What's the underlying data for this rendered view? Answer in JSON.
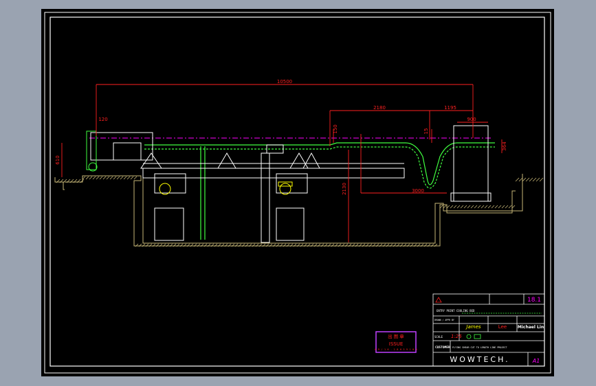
{
  "dimensions": {
    "overall_length": "10500",
    "segment_a": "2180",
    "segment_b": "1195",
    "upper_width": "900",
    "left_small": "120",
    "left_height": "610",
    "rise_150": "150",
    "rise_15": "15",
    "side_364": "364",
    "pit_depth": "2130",
    "loop_width": "3000"
  },
  "title_block": {
    "drawing_title": "ENTRY POINT COOLING BED",
    "row_designed_label": "DRAWN / APPR BY",
    "designer": "James",
    "checker": "Lee",
    "approver": "Michael Lin",
    "scale_label": "SCALE",
    "scale_value": "1:25",
    "customer_label": "CUSTOMER",
    "customer_text": "FLYING SHEAR CUT TO LENGTH LINE PROJECT",
    "company": "WOWTECH.",
    "sheet_number": "18.1",
    "size": "A1"
  },
  "stamp": {
    "top_text": "出 图 章",
    "issue_label": "ISSUE",
    "bottom_text": "0 9 / 1 6 - 2 8  H 3 9 1 0 3"
  },
  "colors": {
    "sheet": "#000000",
    "frame": "#ffffff",
    "dimension": "#ff2020",
    "structure": "#ffffff",
    "conveyor": "#40ff40",
    "centerline": "#ff00ff",
    "hatch": "#c8b878",
    "stamp": "#c040ff",
    "highlight": "#ffff00"
  }
}
